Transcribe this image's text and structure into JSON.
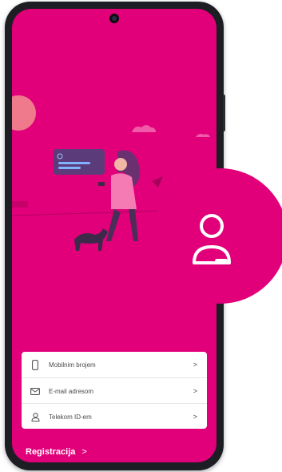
{
  "login_options": [
    {
      "label": "Mobilnim brojem",
      "icon": "mobile-phone-icon",
      "chevron": ">"
    },
    {
      "label": "E-mail adresom",
      "icon": "envelope-icon",
      "chevron": ">"
    },
    {
      "label": "Telekom ID-em",
      "icon": "user-icon",
      "chevron": ">"
    }
  ],
  "register": {
    "label": "Registracija",
    "chevron": ">"
  },
  "colors": {
    "brand": "#e2007a",
    "card": "#ffffff",
    "text": "#4a4a4a"
  },
  "badge": {
    "icon": "user-profile-icon"
  }
}
